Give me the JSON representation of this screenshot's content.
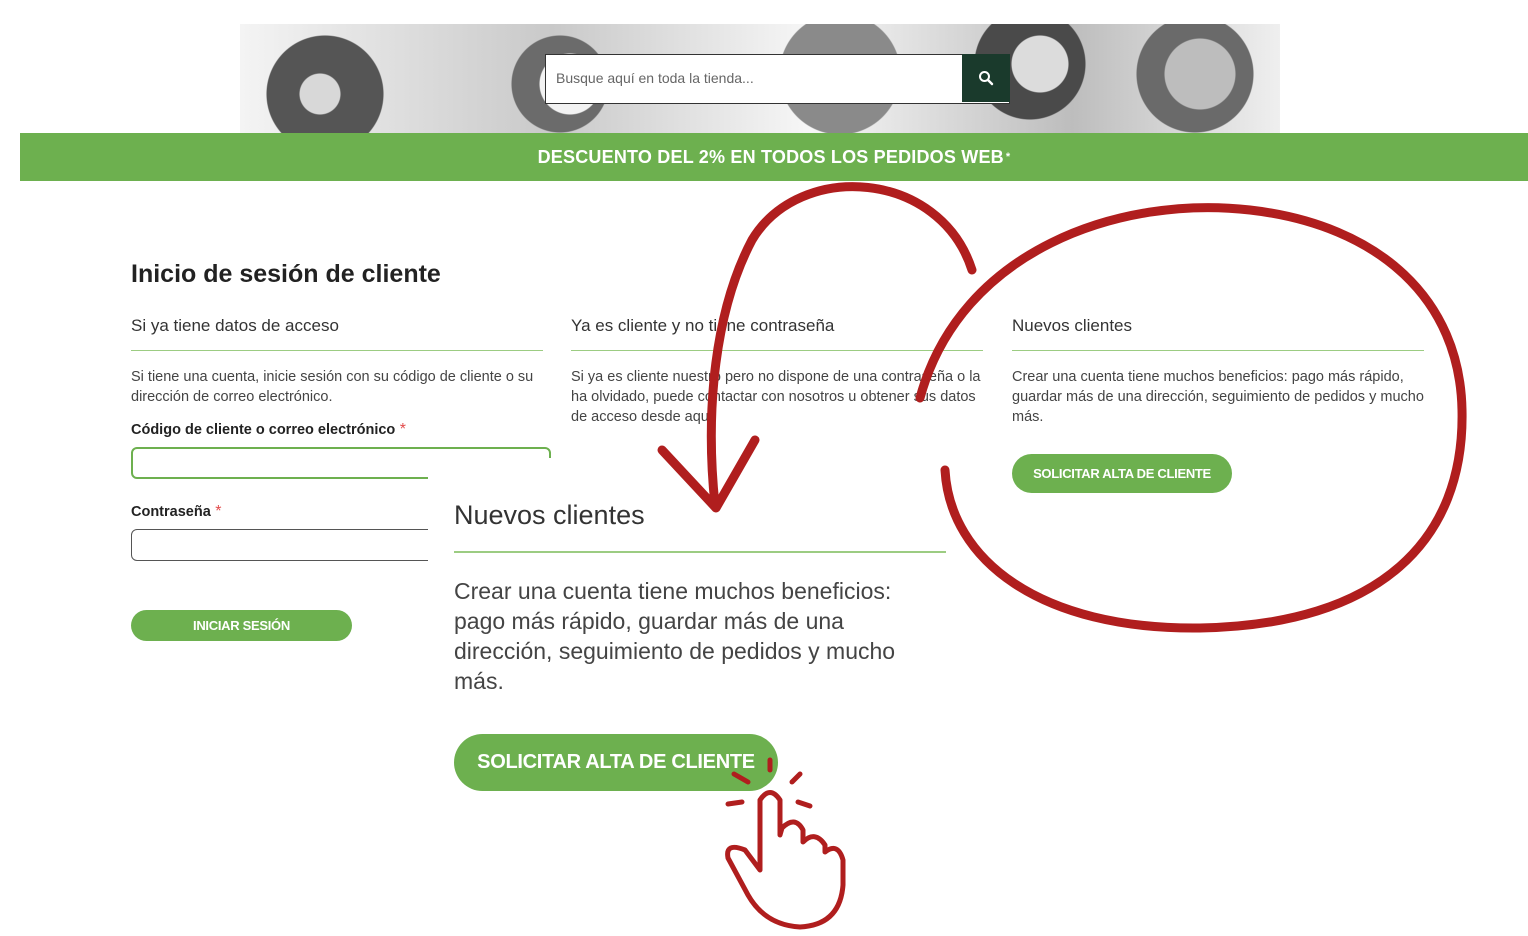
{
  "header": {
    "search_placeholder": "Busque aquí en toda la tienda...",
    "search_icon": "search-icon",
    "promo_text": "DESCUENTO DEL 2% EN TODOS LOS PEDIDOS WEB",
    "promo_mark": "*"
  },
  "login": {
    "title": "Inicio de sesión de cliente",
    "existing": {
      "heading": "Si ya tiene datos de acceso",
      "description": "Si tiene una cuenta, inicie sesión con su código de cliente o su dirección de correo electrónico.",
      "user_label": "Código de cliente o correo electrónico",
      "password_label": "Contraseña",
      "required_mark": "*",
      "user_value": "",
      "password_value": "",
      "submit_label": "INICIAR SESIÓN"
    },
    "no_password": {
      "heading": "Ya es cliente y no tiene contraseña",
      "description": "Si ya es cliente nuestro pero no dispone de una contraseña o la ha olvidado, puede contactar con nosotros u obtener sus datos de acceso desde aquí:"
    },
    "new_customers": {
      "heading": "Nuevos clientes",
      "description": "Crear una cuenta tiene muchos beneficios: pago más rápido, guardar más de una dirección, seguimiento de pedidos y mucho más.",
      "button_label": "SOLICITAR ALTA DE CLIENTE"
    }
  },
  "zoom": {
    "heading": "Nuevos clientes",
    "description": "Crear una cuenta tiene muchos beneficios: pago más rápido, guardar más de una dirección, seguimiento de pedidos y mucho más.",
    "button_label": "SOLICITAR ALTA DE CLIENTE"
  },
  "annotations": {
    "color": "#b01e1e",
    "icons": [
      "red-circle-highlight",
      "curved-arrow-icon",
      "hand-pointer-icon"
    ]
  }
}
